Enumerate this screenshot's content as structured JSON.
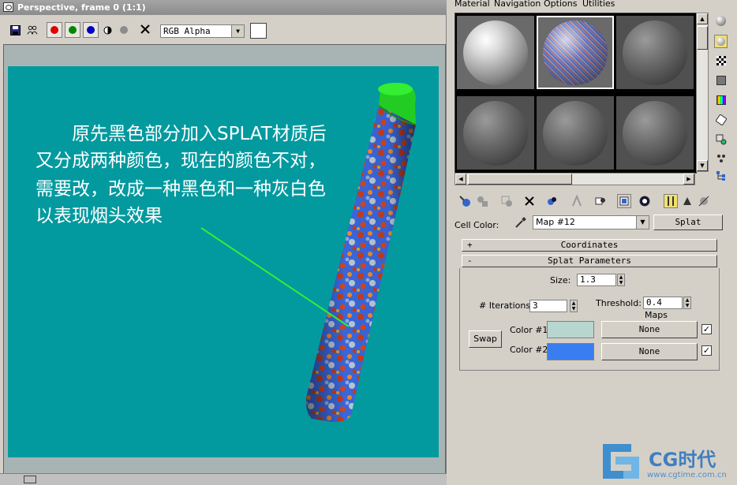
{
  "render_window": {
    "title": "Perspective, frame 0 (1:1)",
    "toolbar": {
      "channel": "RGB Alpha",
      "icons": [
        "save-icon",
        "clone-icon",
        "red-channel-icon",
        "green-channel-icon",
        "blue-channel-icon",
        "alpha-channel-icon",
        "monochrome-icon",
        "clear-icon"
      ]
    },
    "caption_lines": [
      "　　原先黑色部分加入SPLAT材质后",
      "又分成两种颜色，现在的颜色不对，",
      "需要改，改成一种黑色和一种灰白色",
      "以表现烟头效果"
    ],
    "colors": {
      "viewport_bg": "#039a9f",
      "arrow": "#33ee33",
      "cap": "#22cc22"
    }
  },
  "material_editor": {
    "menu": [
      "Material",
      "Navigation",
      "Options",
      "Utilities"
    ],
    "cell_color_label": "Cell Color:",
    "map_name": "Map #12",
    "map_type": "Splat",
    "rollouts": [
      {
        "sign": "+",
        "title": "Coordinates"
      },
      {
        "sign": "-",
        "title": "Splat Parameters"
      }
    ],
    "params": {
      "size_label": "Size:",
      "size_value": "1.3",
      "iterations_label": "# Iterations:",
      "iterations_value": "3",
      "threshold_label": "Threshold:",
      "threshold_value": "0.4",
      "maps_label": "Maps",
      "swap_label": "Swap",
      "color1_label": "Color #1",
      "color2_label": "Color #2",
      "color1": "#b8d6d0",
      "color2": "#3a7df0",
      "map1": "None",
      "map2": "None",
      "map1_checked": "✓",
      "map2_checked": "✓"
    }
  },
  "watermark": {
    "logo_text": "CG时代",
    "url": "www.cgtime.com.cn"
  }
}
